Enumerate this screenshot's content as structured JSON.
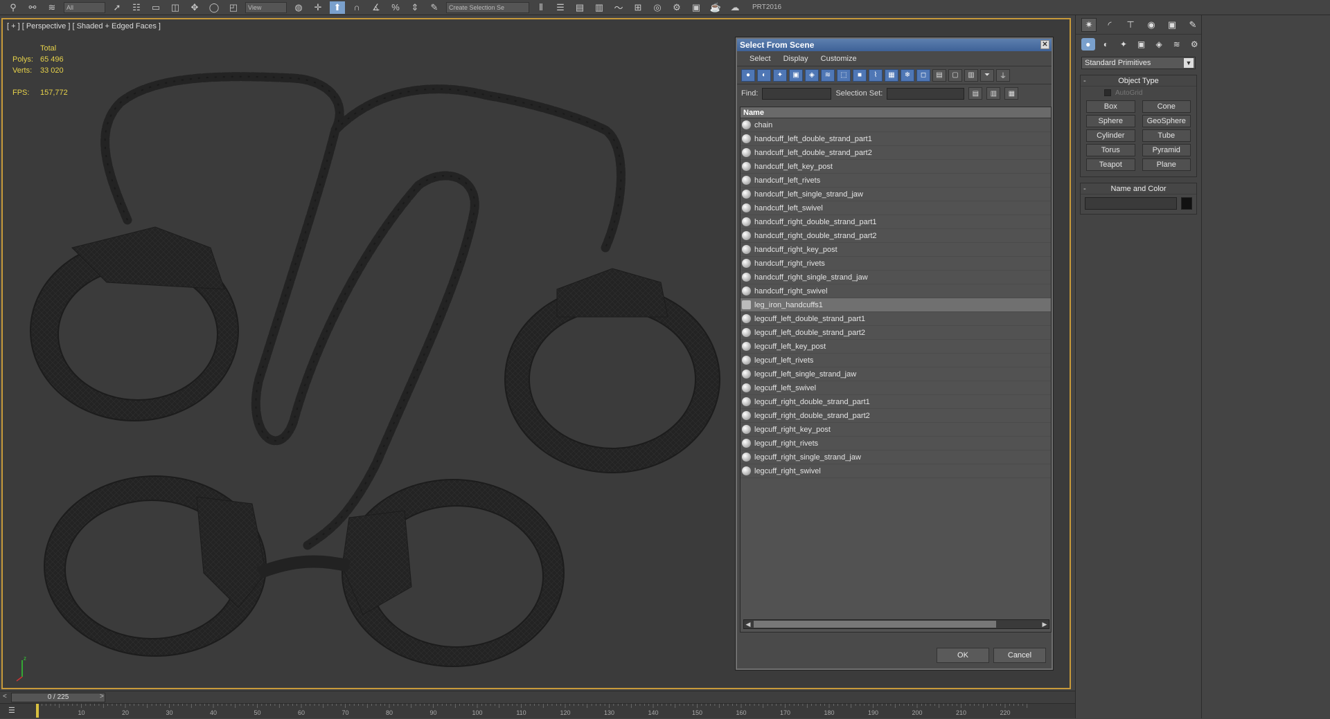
{
  "toolbar": {
    "dropdown_all": "All",
    "dropdown_view": "View",
    "dropdown_selection_set": "Create Selection Se",
    "prt_label": "PRT2016"
  },
  "viewport": {
    "label": "[ + ] [ Perspective ] [ Shaded + Edged Faces ]",
    "stats": {
      "header": "Total",
      "polys_label": "Polys:",
      "polys_value": "65 496",
      "verts_label": "Verts:",
      "verts_value": "33 020",
      "fps_label": "FPS:",
      "fps_value": "157,772"
    }
  },
  "dialog": {
    "title": "Select From Scene",
    "menu": [
      "Select",
      "Display",
      "Customize"
    ],
    "find_label": "Find:",
    "selection_set_label": "Selection Set:",
    "column_header": "Name",
    "items": [
      {
        "name": "chain",
        "type": "object"
      },
      {
        "name": "handcuff_left_double_strand_part1",
        "type": "object"
      },
      {
        "name": "handcuff_left_double_strand_part2",
        "type": "object"
      },
      {
        "name": "handcuff_left_key_post",
        "type": "object"
      },
      {
        "name": "handcuff_left_rivets",
        "type": "object"
      },
      {
        "name": "handcuff_left_single_strand_jaw",
        "type": "object"
      },
      {
        "name": "handcuff_left_swivel",
        "type": "object"
      },
      {
        "name": "handcuff_right_double_strand_part1",
        "type": "object"
      },
      {
        "name": "handcuff_right_double_strand_part2",
        "type": "object"
      },
      {
        "name": "handcuff_right_key_post",
        "type": "object"
      },
      {
        "name": "handcuff_right_rivets",
        "type": "object"
      },
      {
        "name": "handcuff_right_single_strand_jaw",
        "type": "object"
      },
      {
        "name": "handcuff_right_swivel",
        "type": "object"
      },
      {
        "name": "leg_iron_handcuffs1",
        "type": "group",
        "selected": true
      },
      {
        "name": "legcuff_left_double_strand_part1",
        "type": "object"
      },
      {
        "name": "legcuff_left_double_strand_part2",
        "type": "object"
      },
      {
        "name": "legcuff_left_key_post",
        "type": "object"
      },
      {
        "name": "legcuff_left_rivets",
        "type": "object"
      },
      {
        "name": "legcuff_left_single_strand_jaw",
        "type": "object"
      },
      {
        "name": "legcuff_left_swivel",
        "type": "object"
      },
      {
        "name": "legcuff_right_double_strand_part1",
        "type": "object"
      },
      {
        "name": "legcuff_right_double_strand_part2",
        "type": "object"
      },
      {
        "name": "legcuff_right_key_post",
        "type": "object"
      },
      {
        "name": "legcuff_right_rivets",
        "type": "object"
      },
      {
        "name": "legcuff_right_single_strand_jaw",
        "type": "object"
      },
      {
        "name": "legcuff_right_swivel",
        "type": "object"
      }
    ],
    "ok_label": "OK",
    "cancel_label": "Cancel"
  },
  "command_panel": {
    "dropdown": "Standard Primitives",
    "object_type_title": "Object Type",
    "autogrid_label": "AutoGrid",
    "buttons": [
      "Box",
      "Cone",
      "Sphere",
      "GeoSphere",
      "Cylinder",
      "Tube",
      "Torus",
      "Pyramid",
      "Teapot",
      "Plane"
    ],
    "name_color_title": "Name and Color"
  },
  "timeline": {
    "frame_label": "0 / 225",
    "ticks": [
      "10",
      "20",
      "30",
      "40",
      "50",
      "60",
      "70",
      "80",
      "90",
      "100",
      "110",
      "120",
      "130",
      "140",
      "150",
      "160",
      "170",
      "180",
      "190",
      "200",
      "210",
      "220"
    ]
  },
  "colors": {
    "viewport_border": "#c89a3a",
    "stats_text": "#e8d34a",
    "dialog_title": "#3e6298",
    "active_tool": "#7aa0cc"
  }
}
